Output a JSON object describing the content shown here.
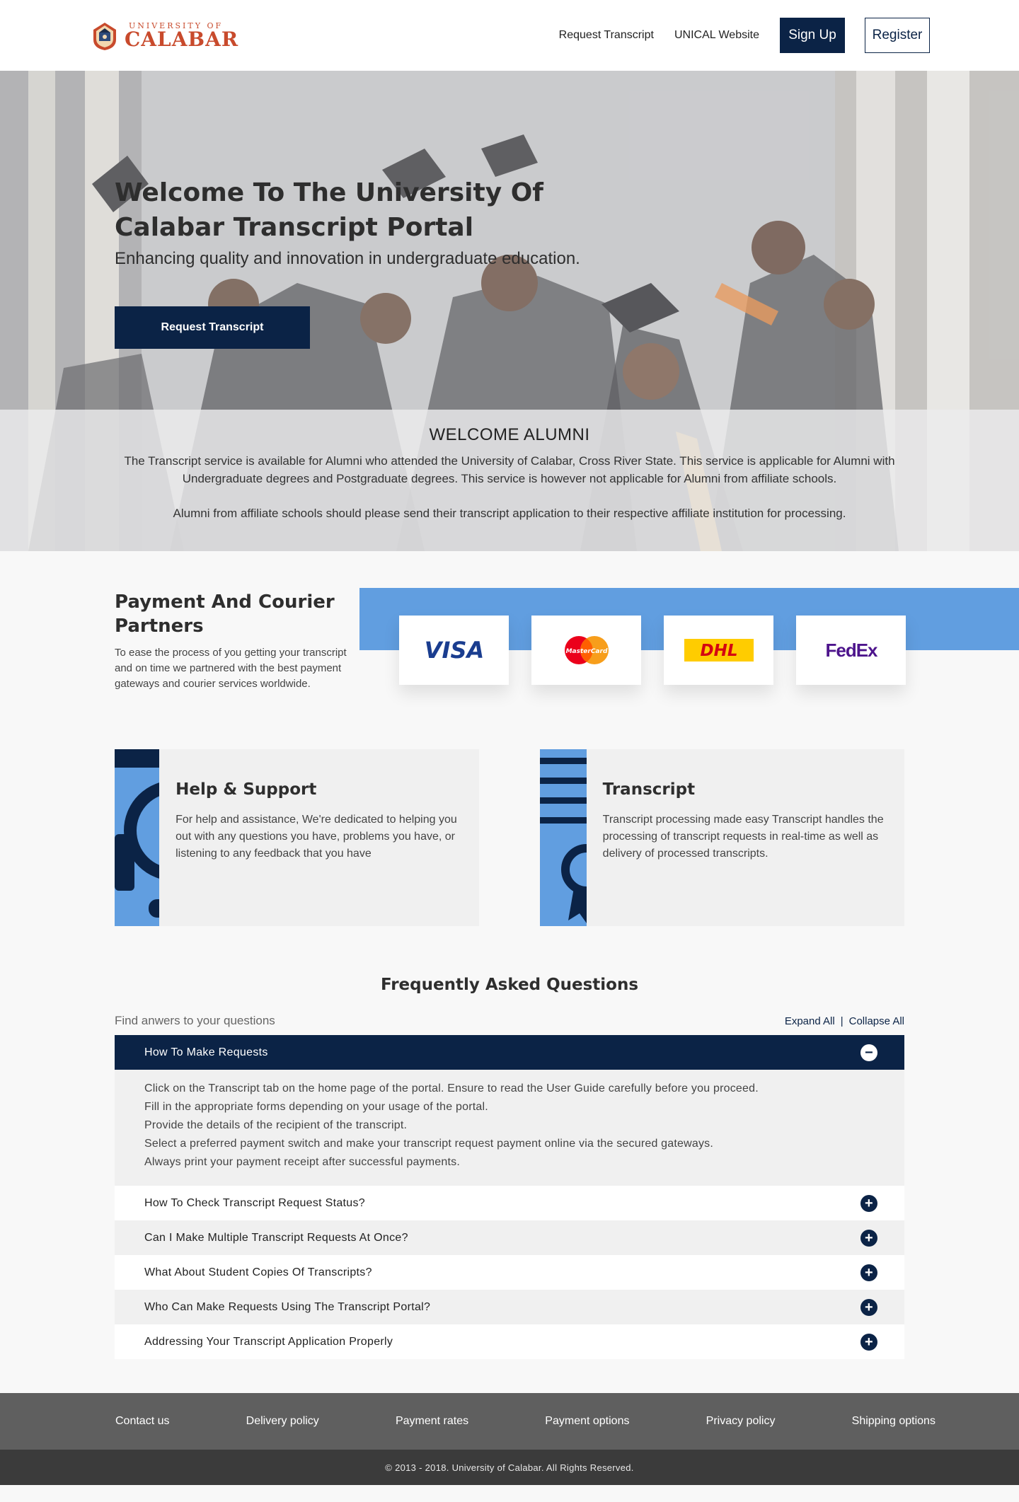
{
  "header": {
    "logo_small": "UNIVERSITY OF",
    "logo_big": "CALABAR",
    "nav": [
      "Request Transcript",
      "UNICAL Website"
    ],
    "signup_label": "Sign Up",
    "register_label": "Register"
  },
  "hero": {
    "title": "Welcome To The University Of Calabar Transcript Portal",
    "subtitle": "Enhancing quality and innovation in undergraduate education.",
    "cta_label": "Request Transcript"
  },
  "alumni": {
    "heading": "WELCOME ALUMNI",
    "para1": "The Transcript service is available for Alumni who attended the University of Calabar, Cross River State. This service is applicable for Alumni with Undergraduate degrees and Postgraduate degrees. This service is however not applicable for Alumni from affiliate schools.",
    "para2": "Alumni from affiliate schools should please send their transcript application to their respective affiliate institution for processing."
  },
  "partners": {
    "title": "Payment And Courier Partners",
    "text": "To ease the process of you getting your transcript and on time we partnered with the best payment gateways and courier services worldwide.",
    "logos": [
      {
        "name": "VISA",
        "color": "#1a3d8f"
      },
      {
        "name": "MasterCard",
        "color": "#eb001b"
      },
      {
        "name": "DHL",
        "color": "#d40511"
      },
      {
        "name": "FedEx",
        "color": "#4d148c"
      }
    ]
  },
  "features": [
    {
      "title": "Help & Support",
      "text": "For help and assistance, We're dedicated to helping you out with any questions you have, problems you have, or listening to any feedback that you have",
      "icon": "headset-icon"
    },
    {
      "title": "Transcript",
      "text": "Transcript processing made easy Transcript handles the processing of transcript requests in real-time as well as delivery of processed transcripts.",
      "icon": "certificate-icon"
    }
  ],
  "faq": {
    "title": "Frequently Asked Questions",
    "find": "Find anwers to your questions",
    "expand": "Expand All",
    "sep": "|",
    "collapse": "Collapse All",
    "open_question": "How To Make Requests",
    "open_answer": [
      "Click on the Transcript tab on the home page of the portal. Ensure to read the User Guide carefully before you proceed.",
      "Fill in the appropriate forms depending on your usage of the portal.",
      "Provide the details of the recipient of the transcript.",
      "Select a preferred payment switch and make your transcript request payment online via the secured gateways.",
      "Always print your payment receipt after successful payments."
    ],
    "questions": [
      "How To Check Transcript Request Status?",
      "Can I Make Multiple Transcript Requests At Once?",
      "What About Student Copies Of Transcripts?",
      "Who Can Make Requests Using The Transcript Portal?",
      "Addressing Your Transcript Application Properly"
    ]
  },
  "footer": {
    "links": [
      "Contact us",
      "Delivery policy",
      "Payment rates",
      "Payment options",
      "Privacy policy",
      "Shipping options"
    ],
    "copyright": "© 2013 - 2018. University of Calabar. All Rights Reserved."
  },
  "colors": {
    "navy": "#0b2346",
    "accent_blue": "#619ee0",
    "brand_red": "#c84a2c"
  }
}
